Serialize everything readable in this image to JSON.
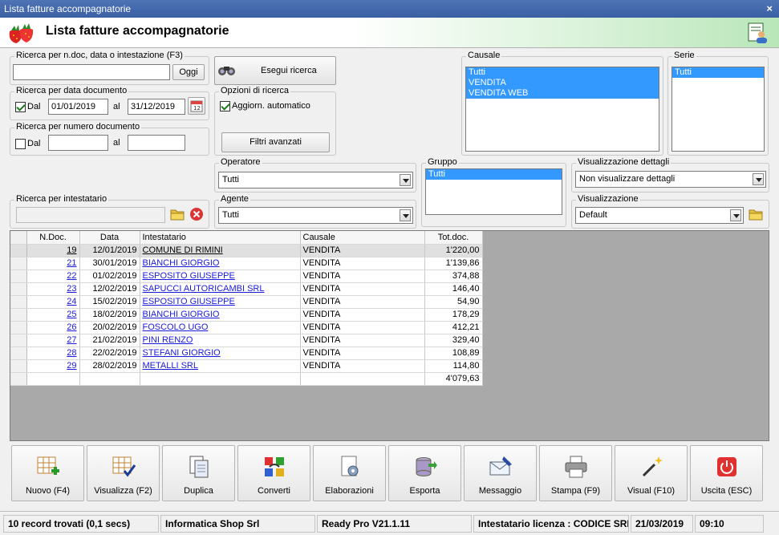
{
  "window": {
    "title": "Lista fatture accompagnatorie",
    "close_glyph": "×"
  },
  "header": {
    "title": "Lista fatture accompagnatorie",
    "logo_icon": "strawberry-icon",
    "right_icon": "user-list-icon"
  },
  "search_text": {
    "label": "Ricerca per n.doc, data o intestazione (F3)",
    "value": "",
    "today_button": "Oggi"
  },
  "search_button": {
    "label": "Esegui ricerca",
    "icon": "binoculars-icon"
  },
  "date_search": {
    "label": "Ricerca per data documento",
    "from_checkbox_label": "Dal",
    "from_checked": true,
    "from_value": "01/01/2019",
    "to_label": "al",
    "to_value": "31/12/2019",
    "calendar_icon": "calendar-icon"
  },
  "options": {
    "label": "Opzioni di ricerca",
    "auto_update_label": "Aggiorn. automatico",
    "auto_update_checked": true,
    "advanced_filters_button": "Filtri avanzati"
  },
  "number_search": {
    "label": "Ricerca per numero documento",
    "from_checkbox_label": "Dal",
    "from_checked": false,
    "from_value": "",
    "to_label": "al",
    "to_value": ""
  },
  "causale": {
    "label": "Causale",
    "items": [
      "Tutti",
      "VENDITA",
      "VENDITA WEB"
    ]
  },
  "serie": {
    "label": "Serie",
    "items": [
      "Tutti"
    ]
  },
  "operatore": {
    "label": "Operatore",
    "value": "Tutti"
  },
  "gruppo": {
    "label": "Gruppo",
    "items": [
      "Tutti"
    ]
  },
  "dettagli": {
    "label": "Visualizzazione dettagli",
    "value": "Non visualizzare dettagli"
  },
  "intestatario": {
    "label": "Ricerca per intestatario",
    "value": ""
  },
  "agente": {
    "label": "Agente",
    "value": "Tutti"
  },
  "visualizzazione": {
    "label": "Visualizzazione",
    "value": "Default"
  },
  "table": {
    "columns": [
      "N.Doc.",
      "Data",
      "Intestatario",
      "Causale",
      "Tot.doc."
    ],
    "rows": [
      {
        "ndoc": "19",
        "data": "12/01/2019",
        "intestatario": "COMUNE DI RIMINI",
        "causale": "VENDITA",
        "tot": "1'220,00"
      },
      {
        "ndoc": "21",
        "data": "30/01/2019",
        "intestatario": "BIANCHI GIORGIO",
        "causale": "VENDITA",
        "tot": "1'139,86"
      },
      {
        "ndoc": "22",
        "data": "01/02/2019",
        "intestatario": "ESPOSITO GIUSEPPE",
        "causale": "VENDITA",
        "tot": "374,88"
      },
      {
        "ndoc": "23",
        "data": "12/02/2019",
        "intestatario": "SAPUCCI AUTORICAMBI SRL",
        "causale": "VENDITA",
        "tot": "146,40"
      },
      {
        "ndoc": "24",
        "data": "15/02/2019",
        "intestatario": "ESPOSITO GIUSEPPE",
        "causale": "VENDITA",
        "tot": "54,90"
      },
      {
        "ndoc": "25",
        "data": "18/02/2019",
        "intestatario": "BIANCHI GIORGIO",
        "causale": "VENDITA",
        "tot": "178,29"
      },
      {
        "ndoc": "26",
        "data": "20/02/2019",
        "intestatario": "FOSCOLO UGO",
        "causale": "VENDITA",
        "tot": "412,21"
      },
      {
        "ndoc": "27",
        "data": "21/02/2019",
        "intestatario": "PINI RENZO",
        "causale": "VENDITA",
        "tot": "329,40"
      },
      {
        "ndoc": "28",
        "data": "22/02/2019",
        "intestatario": "STEFANI GIORGIO",
        "causale": "VENDITA",
        "tot": "108,89"
      },
      {
        "ndoc": "29",
        "data": "28/02/2019",
        "intestatario": "METALLI SRL",
        "causale": "VENDITA",
        "tot": "114,80"
      }
    ],
    "total": "4'079,63"
  },
  "toolbar": [
    {
      "label": "Nuovo (F4)",
      "icon": "grid-add-icon"
    },
    {
      "label": "Visualizza (F2)",
      "icon": "grid-check-icon"
    },
    {
      "label": "Duplica",
      "icon": "duplicate-icon"
    },
    {
      "label": "Converti",
      "icon": "convert-icon"
    },
    {
      "label": "Elaborazioni",
      "icon": "gear-document-icon"
    },
    {
      "label": "Esporta",
      "icon": "database-export-icon"
    },
    {
      "label": "Messaggio",
      "icon": "envelope-pen-icon"
    },
    {
      "label": "Stampa (F9)",
      "icon": "printer-icon"
    },
    {
      "label": "Visual (F10)",
      "icon": "magic-wand-icon"
    },
    {
      "label": "Uscita (ESC)",
      "icon": "power-icon"
    }
  ],
  "status": {
    "records": "10 record trovati (0,1 secs)",
    "company": "Informatica Shop Srl",
    "version": "Ready Pro V21.1.11",
    "license": "Intestatario licenza : CODICE SRL",
    "date": "21/03/2019",
    "time": "09:10"
  },
  "colors": {
    "selection": "#3399ff",
    "title_bar": "#4f74b6",
    "link": "#1a1adc"
  }
}
